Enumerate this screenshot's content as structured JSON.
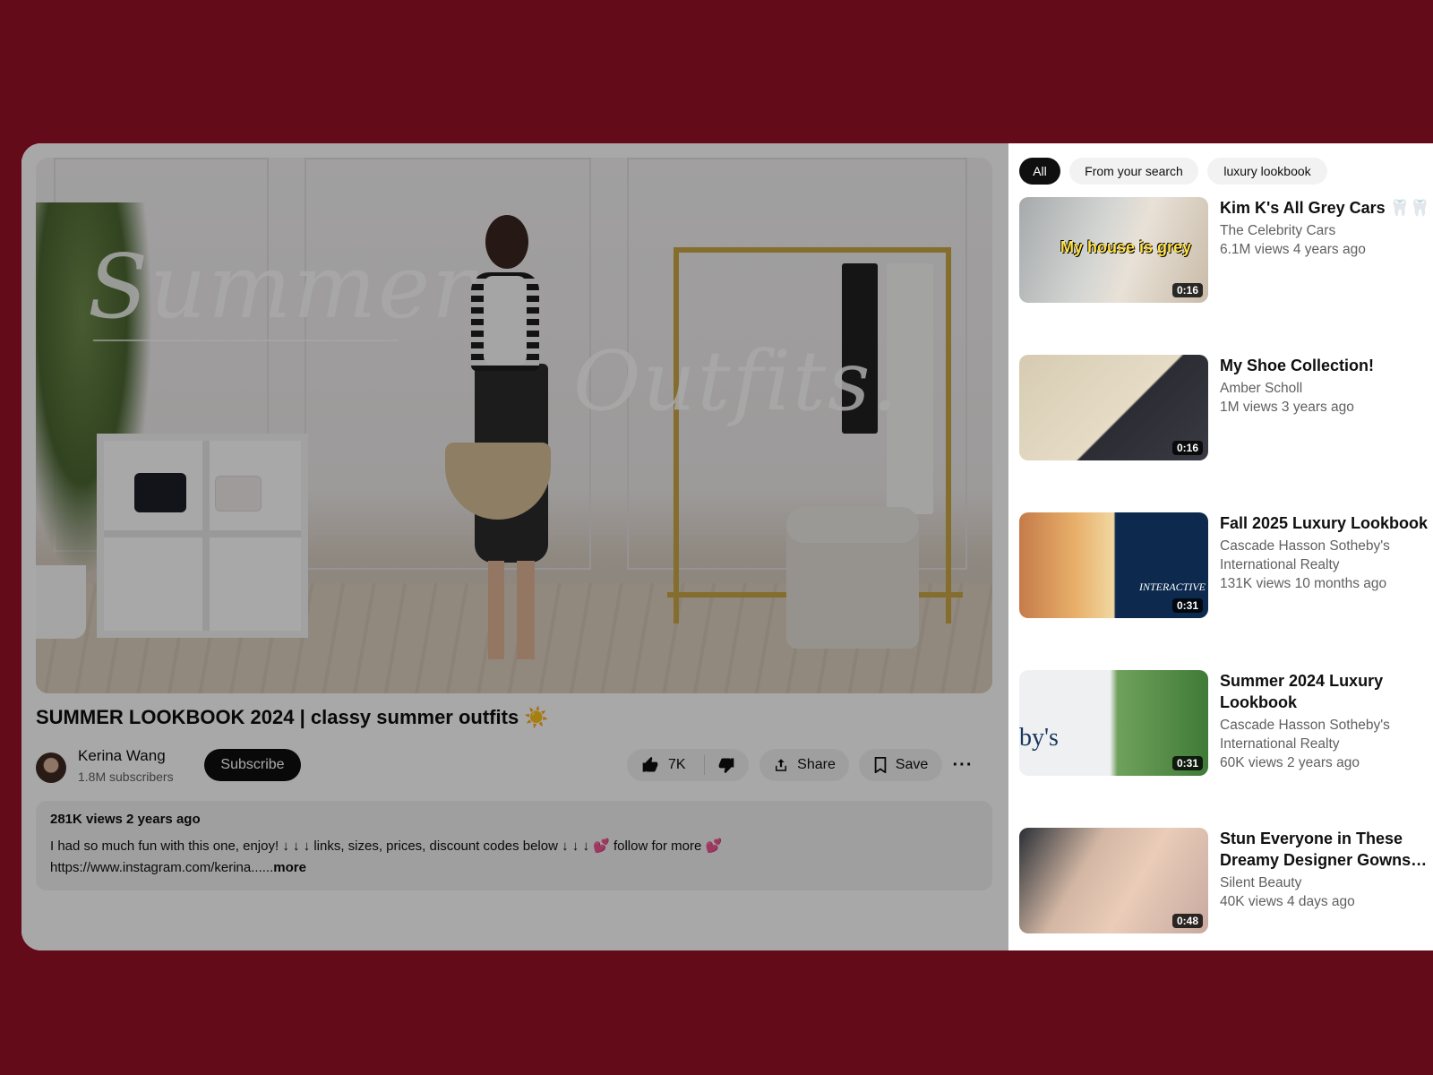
{
  "video": {
    "title": "SUMMER LOOKBOOK 2024 | classy summer outfits ☀️",
    "overlay_text_1": "Summer",
    "overlay_text_2": "Outfits."
  },
  "channel": {
    "name": "Kerina Wang",
    "subscribers": "1.8M subscribers",
    "subscribe_label": "Subscribe"
  },
  "actions": {
    "likes": "7K",
    "share_label": "Share",
    "save_label": "Save",
    "more_label": "···",
    "icons": [
      "thumbs-up-icon",
      "thumbs-down-icon",
      "share-icon",
      "bookmark-icon",
      "more-icon"
    ]
  },
  "description": {
    "stats": "281K views 2 years ago",
    "line1": "I had so much fun with this one, enjoy! ↓ ↓ ↓ links, sizes, prices, discount codes below ↓ ↓ ↓ 💕 follow for more 💕",
    "line2": "https://www.instagram.com/kerina......",
    "more_label": "more"
  },
  "chips": [
    "All",
    "From your search",
    "luxury lookbook"
  ],
  "recommendations": [
    {
      "title": "Kim K's All Grey Cars 🦷🦷",
      "channel": "The Celebrity Cars",
      "meta": "6.1M views 4 years ago",
      "duration": "0:16",
      "thumb_text": "My house is grey"
    },
    {
      "title": "My Shoe Collection!",
      "channel": "Amber Scholl",
      "meta": "1M views 3 years ago",
      "duration": "0:16"
    },
    {
      "title": "Fall 2025 Luxury Lookbook",
      "channel": "Cascade Hasson Sotheby's International Realty",
      "meta": "131K views 10 months ago",
      "duration": "0:31",
      "thumb_text": "INTERACTIVE"
    },
    {
      "title": "Summer 2024 Luxury Lookbook",
      "channel": "Cascade Hasson Sotheby's International Realty",
      "meta": "60K views 2 years ago",
      "duration": "0:31",
      "thumb_text": "by's"
    },
    {
      "title": "Stun Everyone in These Dreamy Designer Gowns…",
      "channel": "Silent Beauty",
      "meta": "40K views 4 days ago",
      "duration": "0:48"
    }
  ],
  "colors": {
    "background": "#640b19",
    "text_primary": "#0f0f0f",
    "text_secondary": "#606060",
    "chip_bg": "#f2f2f2",
    "accent_dark": "#0f0f0f"
  }
}
